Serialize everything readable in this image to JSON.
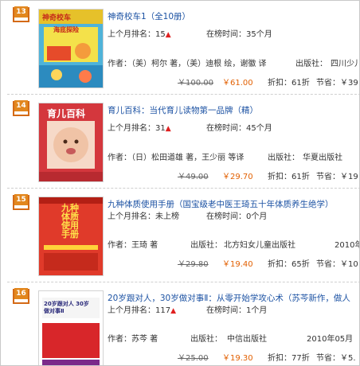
{
  "items": [
    {
      "rank": "13",
      "title": "神奇校车1（全10册）",
      "rank_last_month_label": "上个月排名：",
      "rank_last_month": "15",
      "on_list_label": "在榜时间：",
      "on_list": "35个月",
      "author_line": "作者：（美）柯尔 著，（美）迪根 绘，谢徽 译",
      "publisher_label": "出版社：",
      "publisher": "四川少儿",
      "list_price": "￥100.00",
      "price": "￥61.00",
      "discount_label": "折扣：",
      "discount": "61折",
      "saving_label": "节省：",
      "saving": "￥39",
      "cover_title": "神奇校车",
      "cover_sub": "海底探险"
    },
    {
      "rank": "14",
      "title": "育儿百科：当代育儿读物第一品牌（精）",
      "rank_last_month_label": "上个月排名：",
      "rank_last_month": "31",
      "on_list_label": "在榜时间：",
      "on_list": "45个月",
      "author_line": "作者：（日）松田道雄 著，王少丽 等译",
      "publisher_label": "出版社：",
      "publisher": "华夏出版社",
      "list_price": "￥49.00",
      "price": "￥29.70",
      "discount_label": "折扣：",
      "discount": "61折",
      "saving_label": "节省：",
      "saving": "￥19",
      "cover_title": "育儿百科"
    },
    {
      "rank": "15",
      "title": "九种体质使用手册（国宝级老中医王琦五十年体质养生绝学）",
      "rank_last_month_label": "上个月排名：",
      "rank_last_month": "未上榜",
      "on_list_label": "在榜时间：",
      "on_list": "0个月",
      "author_line": "作者：王琦 著",
      "publisher_label": "出版社：",
      "publisher": "北方妇女儿童出版社",
      "pub_date": "2010年0",
      "list_price": "￥29.80",
      "price": "￥19.40",
      "discount_label": "折扣：",
      "discount": "65折",
      "saving_label": "节省：",
      "saving": "￥10",
      "cover_title": "九种体质使用手册"
    },
    {
      "rank": "16",
      "title": "20岁跟对人，30岁做对事Ⅱ：从零开始学攻心术（苏芩新作，做人",
      "rank_last_month_label": "上个月排名：",
      "rank_last_month": "117",
      "on_list_label": "在榜时间：",
      "on_list": "1个月",
      "author_line": "作者：苏芩 著",
      "publisher_label": "出版社：",
      "publisher": "中信出版社",
      "pub_date": "2010年05月",
      "list_price": "￥25.00",
      "price": "￥19.30",
      "discount_label": "折扣：",
      "discount": "77折",
      "saving_label": "节省：",
      "saving": "￥5.",
      "cover_title": "20岁跟对人 30岁做对事Ⅱ"
    }
  ]
}
